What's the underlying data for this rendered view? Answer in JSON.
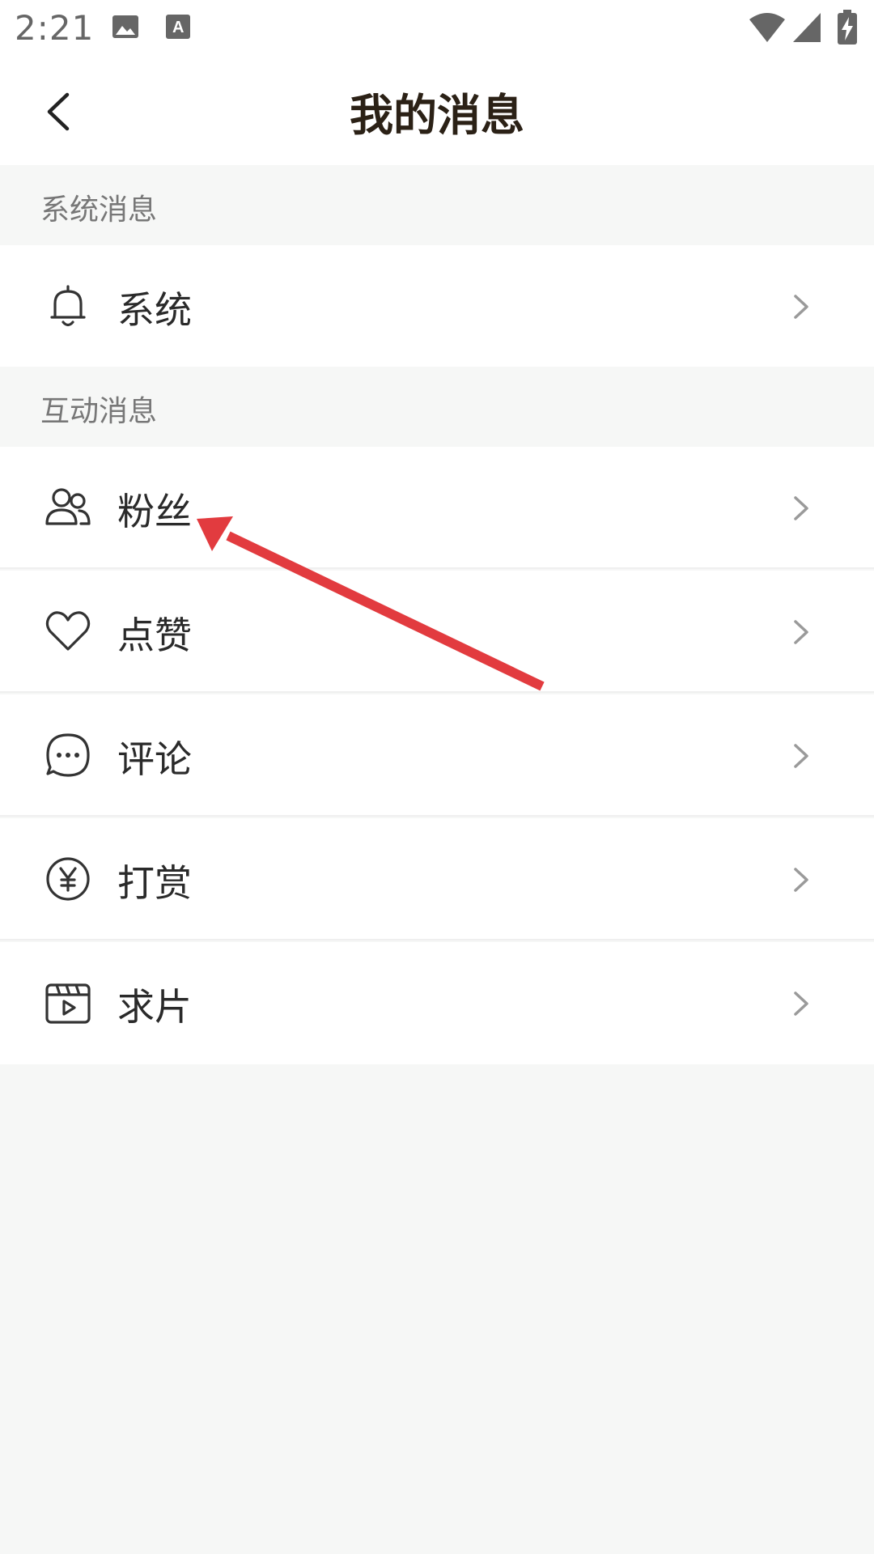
{
  "status_bar": {
    "time": "2:21",
    "icons": [
      "image-icon",
      "text-a-icon",
      "wifi-icon",
      "signal-icon",
      "battery-charging-icon"
    ]
  },
  "header": {
    "title": "我的消息",
    "back_icon": "chevron-left-icon"
  },
  "sections": [
    {
      "title": "系统消息",
      "items": [
        {
          "label": "系统",
          "icon": "bell-icon"
        }
      ]
    },
    {
      "title": "互动消息",
      "items": [
        {
          "label": "粉丝",
          "icon": "users-icon"
        },
        {
          "label": "点赞",
          "icon": "heart-icon"
        },
        {
          "label": "评论",
          "icon": "chat-bubble-icon"
        },
        {
          "label": "打赏",
          "icon": "yen-coin-icon"
        },
        {
          "label": "求片",
          "icon": "video-clapper-icon"
        }
      ]
    }
  ],
  "colors": {
    "background": "#f6f7f6",
    "row_background": "#ffffff",
    "title_text": "#2b2116",
    "section_text": "#777777",
    "icon_stroke": "#333333",
    "chevron": "#9a9a9a",
    "annotation_arrow": "#e23b3f"
  }
}
